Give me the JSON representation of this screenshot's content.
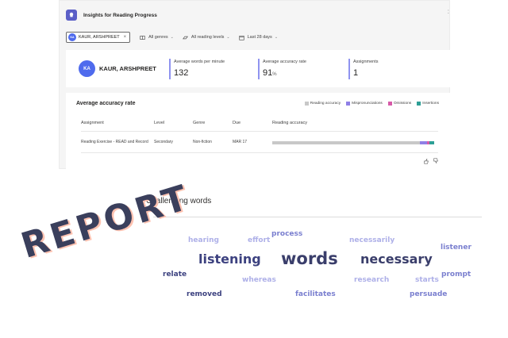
{
  "app": {
    "title": "Insights for Reading Progress",
    "menu_glyph": ":"
  },
  "filters": {
    "student_initials": "KA",
    "student_name": "KAUR, ARSHPREET",
    "clear_glyph": "×",
    "genres": "All genres",
    "levels": "All reading levels",
    "date_range": "Last 28 days",
    "chevron": "⌄"
  },
  "summary": {
    "initials": "KA",
    "name": "KAUR, ARSHPREET",
    "metrics": [
      {
        "label": "Average words per minute",
        "value": "132",
        "unit": ""
      },
      {
        "label": "Average accuracy rate",
        "value": "91",
        "unit": "%"
      },
      {
        "label": "Assignments",
        "value": "1",
        "unit": ""
      }
    ]
  },
  "accuracy_card": {
    "title": "Average accuracy rate",
    "legend": [
      {
        "label": "Reading accuracy",
        "color": "#c8c8c8"
      },
      {
        "label": "Mispronunciations",
        "color": "#8f7fe6"
      },
      {
        "label": "Omissions",
        "color": "#d65aa8"
      },
      {
        "label": "Insertions",
        "color": "#2e9f96"
      }
    ],
    "columns": [
      "Assignment",
      "Level",
      "Genre",
      "Due",
      "Reading accuracy"
    ],
    "rows": [
      {
        "assignment": "Reading Exercise - READ and Record",
        "level": "Secondary",
        "genre": "Non-fiction",
        "due": "MAR 17",
        "accuracy_segments": [
          0.91,
          0.045,
          0.015,
          0.03
        ]
      }
    ]
  },
  "challenging_words": {
    "title": "Challenging words",
    "words": [
      {
        "text": "hearing",
        "color": "#aeb0e8"
      },
      {
        "text": "effort",
        "color": "#aeb0e8"
      },
      {
        "text": "process",
        "color": "#7a7fcf"
      },
      {
        "text": "necessarily",
        "color": "#aeb0e8"
      },
      {
        "text": "listener",
        "color": "#7a7fcf"
      },
      {
        "text": "listening",
        "color": "#3d4280"
      },
      {
        "text": "words",
        "color": "#3a3e6b"
      },
      {
        "text": "necessary",
        "color": "#3a3e6b"
      },
      {
        "text": "relate",
        "color": "#3d4280"
      },
      {
        "text": "whereas",
        "color": "#aeb0e8"
      },
      {
        "text": "research",
        "color": "#aeb0e8"
      },
      {
        "text": "starts",
        "color": "#aeb0e8"
      },
      {
        "text": "prompt",
        "color": "#7a7fcf"
      },
      {
        "text": "removed",
        "color": "#3d4280"
      },
      {
        "text": "facilitates",
        "color": "#7a7fcf"
      },
      {
        "text": "persuade",
        "color": "#7a7fcf"
      }
    ]
  },
  "stamp": {
    "text": "REPORT"
  }
}
